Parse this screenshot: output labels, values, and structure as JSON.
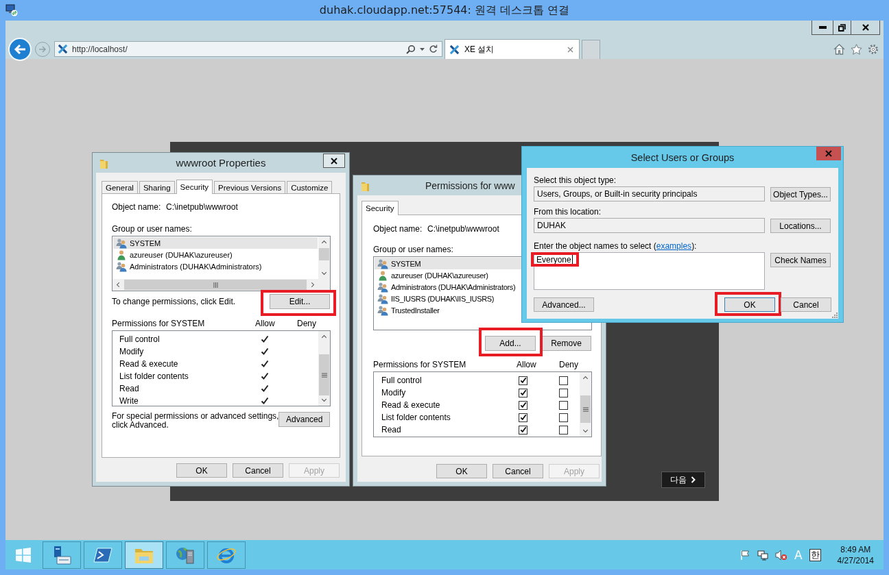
{
  "remote_desktop": {
    "title": "duhak.cloudapp.net:57544: 원격 데스크톱 연결"
  },
  "browser": {
    "address": "http://localhost/",
    "tabs": [
      {
        "label": "XE 설치",
        "selected": true
      }
    ]
  },
  "web_page": {
    "next_button": "다음"
  },
  "properties_dialog": {
    "title": "wwwroot Properties",
    "tabs": [
      {
        "label": "General",
        "selected": false
      },
      {
        "label": "Sharing",
        "selected": false
      },
      {
        "label": "Security",
        "selected": true
      },
      {
        "label": "Previous Versions",
        "selected": false
      },
      {
        "label": "Customize",
        "selected": false
      }
    ],
    "object_name_label": "Object name:",
    "object_name": "C:\\inetpub\\wwwroot",
    "group_label": "Group or user names:",
    "principals": [
      {
        "name": "SYSTEM",
        "kind": "group",
        "selected": true
      },
      {
        "name": "azureuser (DUHAK\\azureuser)",
        "kind": "user",
        "selected": false
      },
      {
        "name": "Administrators (DUHAK\\Administrators)",
        "kind": "group",
        "selected": false
      }
    ],
    "change_hint": "To change permissions, click Edit.",
    "edit_button": {
      "label": "Edit...",
      "highlighted": true
    },
    "permissions_label": "Permissions for SYSTEM",
    "allow_label": "Allow",
    "deny_label": "Deny",
    "permissions": [
      {
        "name": "Full control",
        "allow": true
      },
      {
        "name": "Modify",
        "allow": true
      },
      {
        "name": "Read & execute",
        "allow": true
      },
      {
        "name": "List folder contents",
        "allow": true
      },
      {
        "name": "Read",
        "allow": true
      },
      {
        "name": "Write",
        "allow": true
      }
    ],
    "advanced_hint": "For special permissions or advanced settings,\nclick Advanced.",
    "advanced_button": "Advanced",
    "buttons": [
      {
        "label": "OK",
        "disabled": false
      },
      {
        "label": "Cancel",
        "disabled": false
      },
      {
        "label": "Apply",
        "disabled": true
      }
    ]
  },
  "permissions_dialog": {
    "title": "Permissions for www",
    "tabs": [
      {
        "label": "Security",
        "selected": true
      }
    ],
    "object_name_label": "Object name:",
    "object_name": "C:\\inetpub\\wwwroot",
    "group_label": "Group or user names:",
    "principals": [
      {
        "name": "SYSTEM",
        "kind": "group",
        "selected": true
      },
      {
        "name": "azureuser (DUHAK\\azureuser)",
        "kind": "user",
        "selected": false
      },
      {
        "name": "Administrators (DUHAK\\Administrators)",
        "kind": "group",
        "selected": false
      },
      {
        "name": "IIS_IUSRS (DUHAK\\IIS_IUSRS)",
        "kind": "group",
        "selected": false
      },
      {
        "name": "TrustedInstaller",
        "kind": "group",
        "selected": false
      }
    ],
    "add_button": {
      "label": "Add...",
      "highlighted": true
    },
    "remove_button": "Remove",
    "permissions_label": "Permissions for SYSTEM",
    "allow_label": "Allow",
    "deny_label": "Deny",
    "permissions": [
      {
        "name": "Full control",
        "allow": true,
        "deny": false
      },
      {
        "name": "Modify",
        "allow": true,
        "deny": false
      },
      {
        "name": "Read & execute",
        "allow": true,
        "deny": false
      },
      {
        "name": "List folder contents",
        "allow": true,
        "deny": false
      },
      {
        "name": "Read",
        "allow": true,
        "deny": false
      }
    ],
    "buttons": [
      {
        "label": "OK",
        "disabled": false
      },
      {
        "label": "Cancel",
        "disabled": false
      },
      {
        "label": "Apply",
        "disabled": true
      }
    ]
  },
  "select_dialog": {
    "title": "Select Users or Groups",
    "object_type_label": "Select this object type:",
    "object_type": "Users, Groups, or Built-in security principals",
    "object_types_button": "Object Types...",
    "location_label": "From this location:",
    "location": "DUHAK",
    "locations_button": "Locations...",
    "names_label": {
      "before": "Enter the object names to select (",
      "link": "examples",
      "after": "):"
    },
    "names_value": "Everyone",
    "names_focused": true,
    "names_highlighted": true,
    "check_names_button": "Check Names",
    "advanced_button": "Advanced...",
    "buttons": [
      {
        "label": "OK",
        "default": true,
        "highlighted": true
      },
      {
        "label": "Cancel",
        "default": false,
        "highlighted": false
      }
    ]
  },
  "taskbar": {
    "buttons": [
      {
        "kind": "start",
        "selected": false
      },
      {
        "kind": "server",
        "selected": false
      },
      {
        "kind": "terminal",
        "selected": false
      },
      {
        "kind": "folder",
        "selected": true
      },
      {
        "kind": "globe-server",
        "selected": false
      },
      {
        "kind": "browser",
        "selected": false
      }
    ],
    "tray": [
      {
        "kind": "flag"
      },
      {
        "kind": "network"
      },
      {
        "kind": "speaker-muted"
      },
      {
        "kind": "text",
        "label": "A"
      },
      {
        "kind": "boxed-text",
        "label": "한"
      }
    ],
    "time": "8:49 AM",
    "date": "4/27/2014"
  }
}
